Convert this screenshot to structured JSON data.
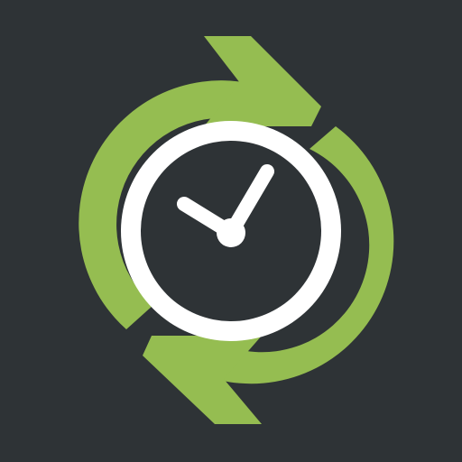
{
  "app_icon": {
    "icon_name": "sync-clock-icon",
    "colors": {
      "background": "#2e3336",
      "arrow": "#95bd51",
      "clock_ring": "#ffffff",
      "clock_face": "#2e3336",
      "hands": "#ffffff"
    }
  }
}
